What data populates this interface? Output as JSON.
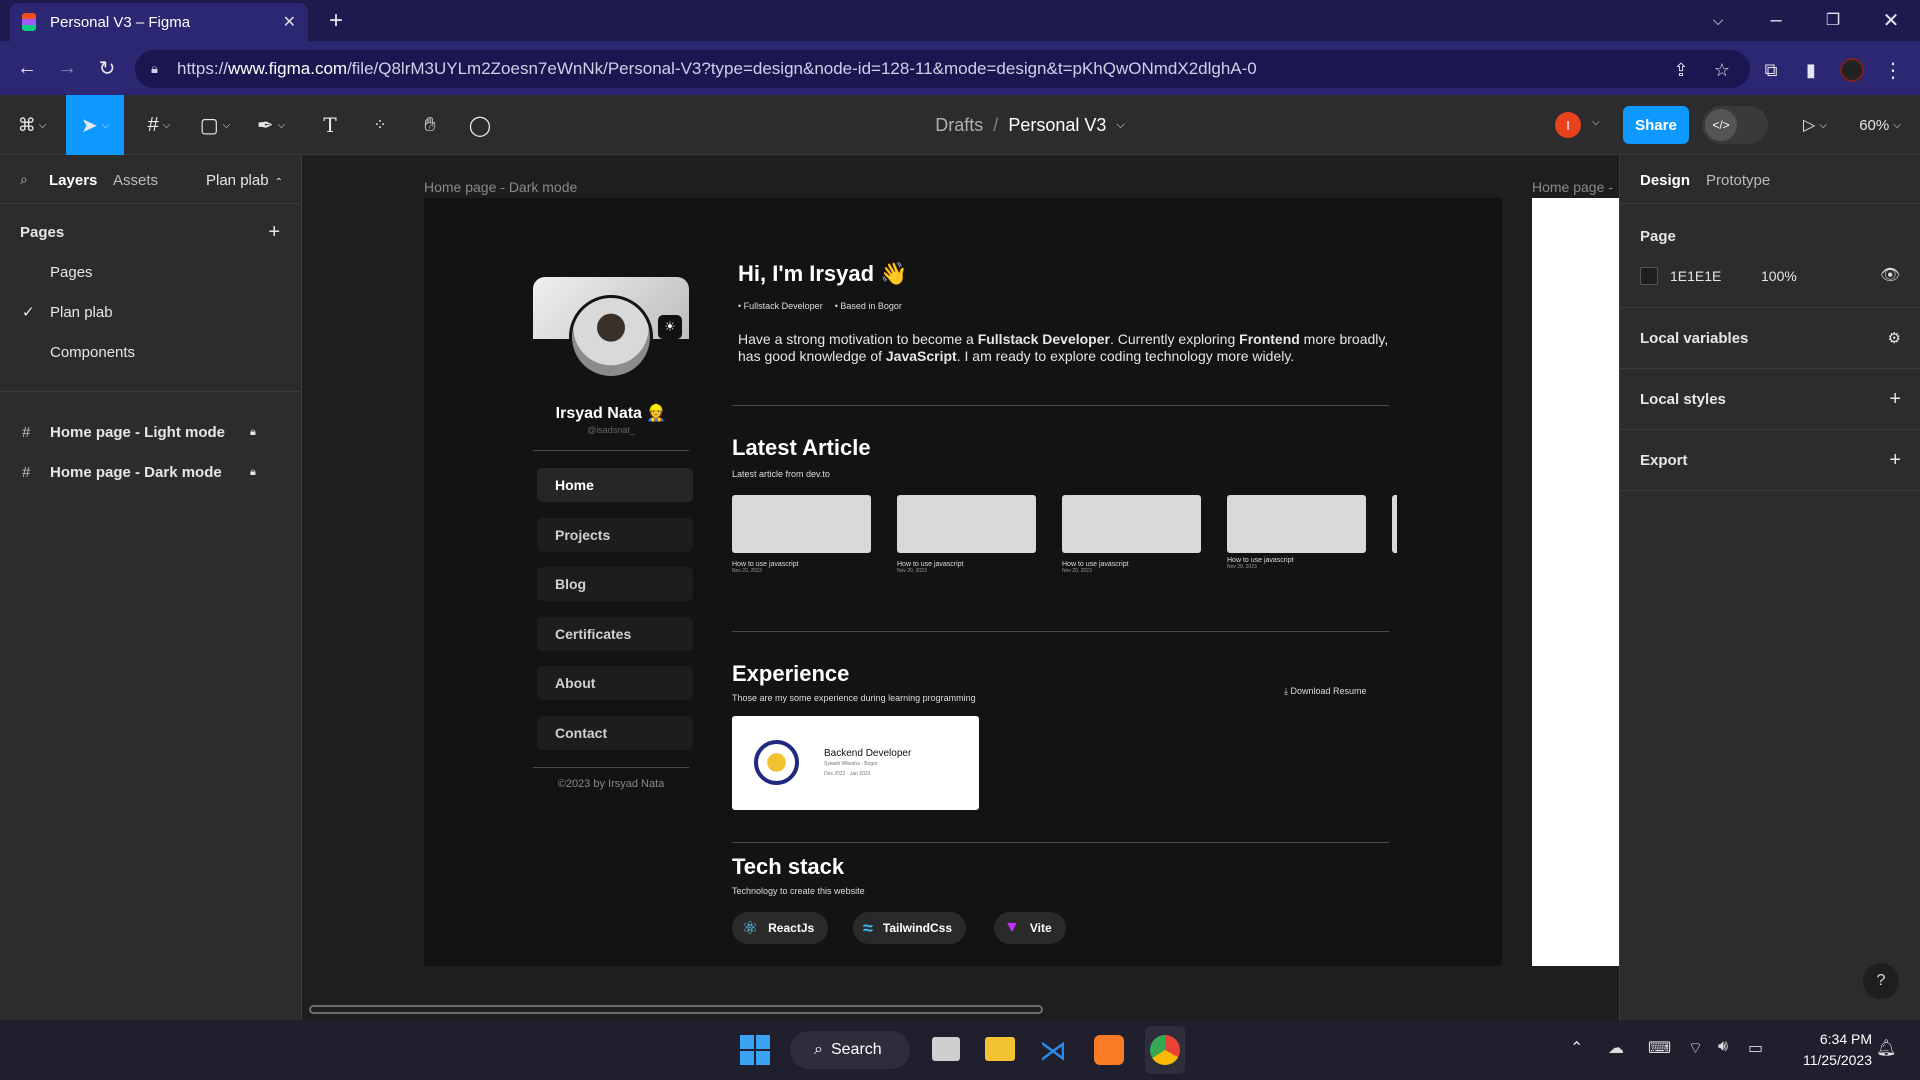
{
  "browser": {
    "tab_title": "Personal V3 – Figma",
    "url_prefix": "https://",
    "url_host": "www.figma.com",
    "url_path": "/file/Q8lrM3UYLm2Zoesn7eWnNk/Personal-V3?type=design&node-id=128-11&mode=design&t=pKhQwONmdX2dlghA-0",
    "profile_initial": ""
  },
  "toolbar": {
    "breadcrumb_parent": "Drafts",
    "breadcrumb_sep": "/",
    "file_name": "Personal V3",
    "avatar_initial": "I",
    "share_label": "Share",
    "zoom": "60%",
    "accent_color": "#0d99ff"
  },
  "left_panel": {
    "tabs": [
      "Layers",
      "Assets"
    ],
    "page_selector": "Plan plab",
    "pages_header": "Pages",
    "pages": [
      "Pages",
      "Plan plab",
      "Components"
    ],
    "current_page": "Plan plab",
    "layers": [
      "Home page - Light mode",
      "Home page - Dark mode"
    ]
  },
  "canvas": {
    "frame_label": "Home page - Dark mode",
    "frame2_label": "Home page -",
    "frame": {
      "name": "Irsyad Nata 👷",
      "handle": "@isadsnat_",
      "nav": [
        "Home",
        "Projects",
        "Blog",
        "Certificates",
        "About",
        "Contact"
      ],
      "footer": "©2023 by Irsyad Nata",
      "greeting": "Hi, I'm Irsyad 👋",
      "tags": [
        "Fullstack Developer",
        "Based in Bogor"
      ],
      "bio_parts": [
        "Have a strong motivation to become a ",
        "Fullstack Developer",
        ". Currently exploring ",
        "Frontend",
        " more broadly, has good knowledge of ",
        "JavaScript",
        ". I am ready to explore coding technology more widely."
      ],
      "articles_title": "Latest Article",
      "articles_sub": "Latest article from dev.to",
      "articles": [
        {
          "title": "How to use javascript",
          "date": "Nov 20, 2023"
        },
        {
          "title": "How to use javascript",
          "date": "Nov 20, 2023"
        },
        {
          "title": "How to use javascript",
          "date": "Nov 20, 2023"
        },
        {
          "title": "How to use javascript",
          "date": "Nov 20, 2023"
        }
      ],
      "experience_title": "Experience",
      "experience_sub": "Those are my some experience during learning programming",
      "download_label": "Download Resume",
      "job": {
        "role": "Backend Developer",
        "company": "Syiweb Wikraha - Bogor",
        "period": "Des 2022 - Jan 2023"
      },
      "tech_title": "Tech stack",
      "tech_sub": "Technology to create this website",
      "tech": [
        "ReactJs",
        "TailwindCss",
        "Vite"
      ]
    }
  },
  "right_panel": {
    "tabs": [
      "Design",
      "Prototype"
    ],
    "page_title": "Page",
    "page_color": "1E1E1E",
    "page_opacity": "100%",
    "sections": [
      "Local variables",
      "Local styles",
      "Export"
    ],
    "help": "?"
  },
  "taskbar": {
    "search_label": "Search",
    "time": "6:34 PM",
    "date": "11/25/2023"
  }
}
